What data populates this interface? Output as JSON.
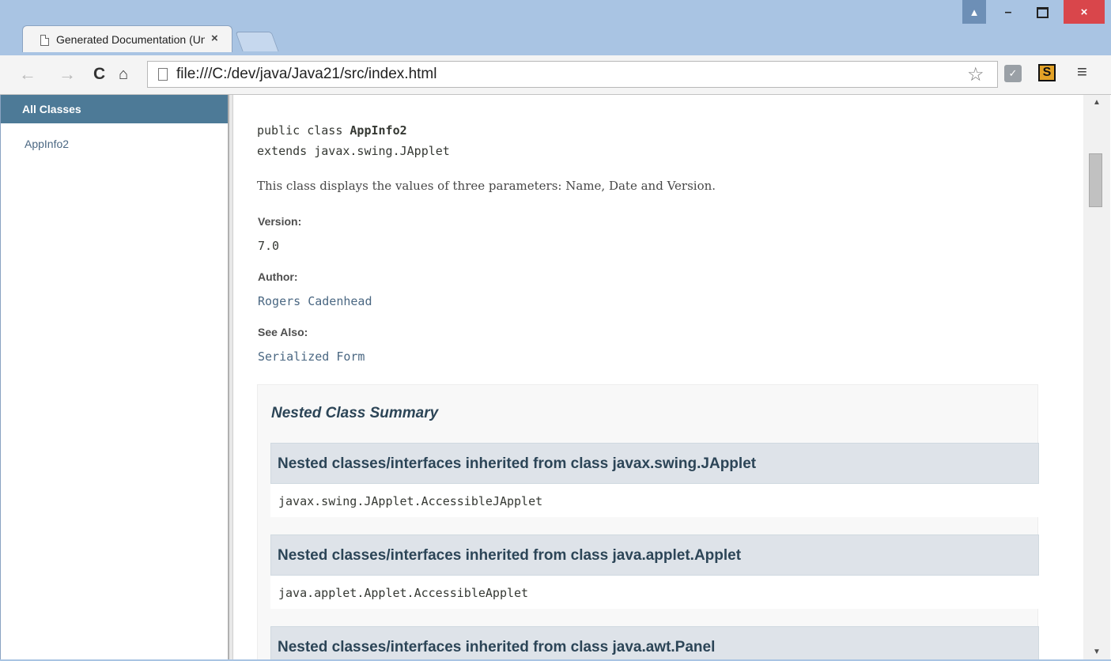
{
  "browser": {
    "tab_title": "Generated Documentation (Untitled)",
    "tab_close": "×",
    "url": "file:///C:/dev/java/Java21/src/index.html",
    "window_controls": {
      "minimize": "–",
      "close": "×"
    },
    "icons": [
      "page-icon",
      "back-arrow-icon",
      "forward-arrow-icon",
      "reload-icon",
      "home-icon",
      "star-icon",
      "menu-icon"
    ]
  },
  "sidebar": {
    "header": "All Classes",
    "items": [
      {
        "label": "AppInfo2"
      }
    ]
  },
  "doc": {
    "signature_prefix": "public class ",
    "class_name": "AppInfo2",
    "extends_line": "extends javax.swing.JApplet",
    "description": "This class displays the values of three parameters: Name, Date and Version.",
    "version_label": "Version:",
    "version_value": "7.0",
    "author_label": "Author:",
    "author_value": "Rogers Cadenhead",
    "see_also_label": "See Also:",
    "see_also_value": "Serialized Form",
    "summary_title": "Nested Class Summary",
    "inherited": [
      {
        "heading": "Nested classes/interfaces inherited from class javax.swing.JApplet",
        "content": "javax.swing.JApplet.AccessibleJApplet"
      },
      {
        "heading": "Nested classes/interfaces inherited from class java.applet.Applet",
        "content": "java.applet.Applet.AccessibleApplet"
      },
      {
        "heading": "Nested classes/interfaces inherited from class java.awt.Panel",
        "content": ""
      }
    ]
  }
}
